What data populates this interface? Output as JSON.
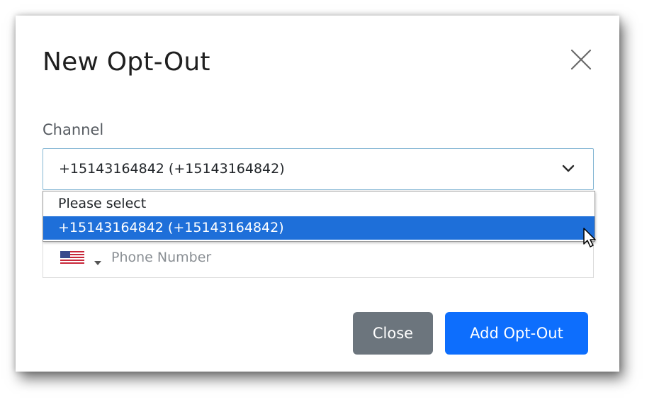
{
  "modal": {
    "title": "New Opt-Out",
    "close_icon": "close-icon"
  },
  "channel": {
    "label": "Channel",
    "selected_value": "+15143164842 (+15143164842)",
    "chevron_icon": "chevron-down-icon",
    "options": [
      {
        "label": "Please select",
        "highlighted": false
      },
      {
        "label": "+15143164842 (+15143164842)",
        "highlighted": true
      }
    ],
    "highlight_color": "#1e6fd9"
  },
  "phone": {
    "country_flag": "us-flag-icon",
    "placeholder": "Phone Number",
    "value": ""
  },
  "buttons": {
    "close_label": "Close",
    "add_label": "Add Opt-Out",
    "close_color": "#6c757d",
    "add_color": "#0d6efd"
  }
}
